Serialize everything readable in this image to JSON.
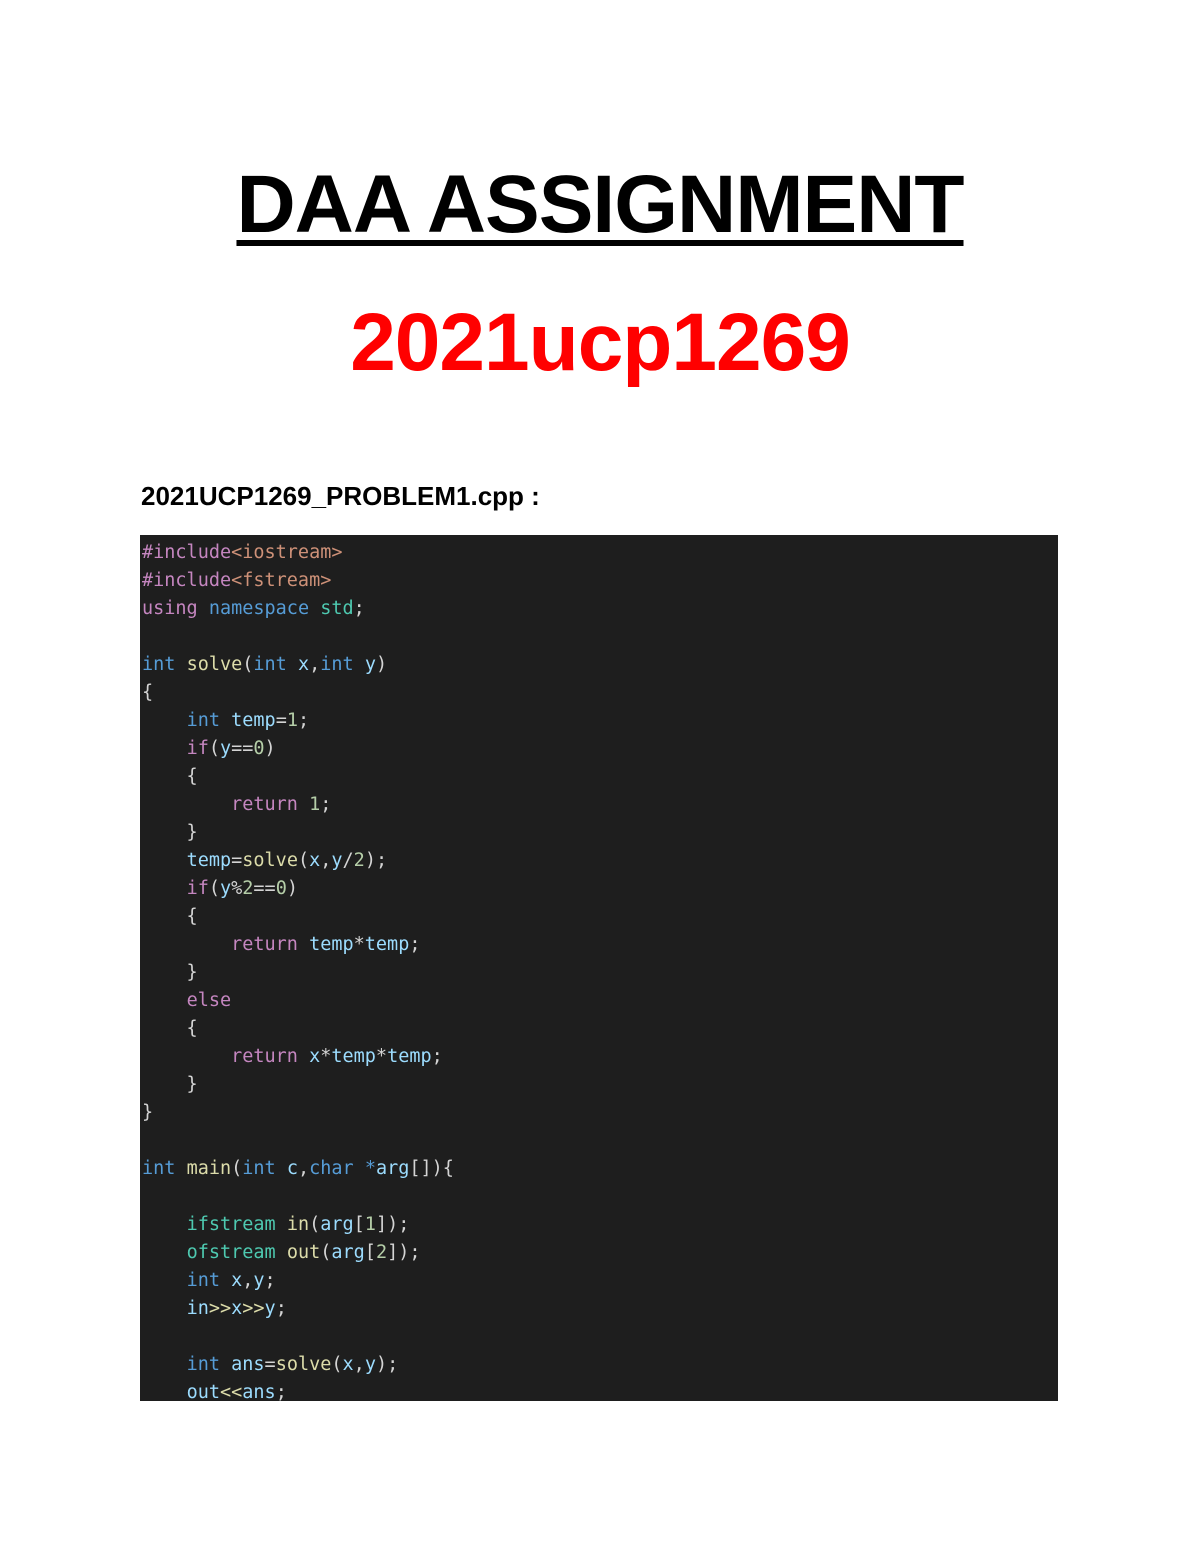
{
  "document": {
    "title": "DAA ASSIGNMENT",
    "roll_number": "2021ucp1269",
    "file_heading": "2021UCP1269_PROBLEM1.cpp :"
  },
  "colors": {
    "roll_number": "#ff0000",
    "code_background": "#1e1e1e"
  },
  "code": {
    "language": "cpp",
    "lines": [
      [
        [
          "pre",
          "#include"
        ],
        [
          "str",
          "<iostream>"
        ]
      ],
      [
        [
          "pre",
          "#include"
        ],
        [
          "str",
          "<fstream>"
        ]
      ],
      [
        [
          "kw",
          "using"
        ],
        [
          "p",
          " "
        ],
        [
          "type",
          "namespace"
        ],
        [
          "p",
          " "
        ],
        [
          "ns",
          "std"
        ],
        [
          "p",
          ";"
        ]
      ],
      [],
      [
        [
          "type",
          "int"
        ],
        [
          "p",
          " "
        ],
        [
          "fn",
          "solve"
        ],
        [
          "p",
          "("
        ],
        [
          "type",
          "int"
        ],
        [
          "p",
          " "
        ],
        [
          "var",
          "x"
        ],
        [
          "p",
          ","
        ],
        [
          "type",
          "int"
        ],
        [
          "p",
          " "
        ],
        [
          "var",
          "y"
        ],
        [
          "p",
          ")"
        ]
      ],
      [
        [
          "p",
          "{"
        ]
      ],
      [
        [
          "p",
          "    "
        ],
        [
          "type",
          "int"
        ],
        [
          "p",
          " "
        ],
        [
          "var",
          "temp"
        ],
        [
          "p",
          "="
        ],
        [
          "num",
          "1"
        ],
        [
          "p",
          ";"
        ]
      ],
      [
        [
          "p",
          "    "
        ],
        [
          "kw",
          "if"
        ],
        [
          "p",
          "("
        ],
        [
          "var",
          "y"
        ],
        [
          "p",
          "=="
        ],
        [
          "num",
          "0"
        ],
        [
          "p",
          ")"
        ]
      ],
      [
        [
          "p",
          "    {"
        ]
      ],
      [
        [
          "p",
          "        "
        ],
        [
          "kw",
          "return"
        ],
        [
          "p",
          " "
        ],
        [
          "num",
          "1"
        ],
        [
          "p",
          ";"
        ]
      ],
      [
        [
          "p",
          "    }"
        ]
      ],
      [
        [
          "p",
          "    "
        ],
        [
          "var",
          "temp"
        ],
        [
          "p",
          "="
        ],
        [
          "fn",
          "solve"
        ],
        [
          "p",
          "("
        ],
        [
          "var",
          "x"
        ],
        [
          "p",
          ","
        ],
        [
          "var",
          "y"
        ],
        [
          "p",
          "/"
        ],
        [
          "num",
          "2"
        ],
        [
          "p",
          ");"
        ]
      ],
      [
        [
          "p",
          "    "
        ],
        [
          "kw",
          "if"
        ],
        [
          "p",
          "("
        ],
        [
          "var",
          "y"
        ],
        [
          "p",
          "%"
        ],
        [
          "num",
          "2"
        ],
        [
          "p",
          "=="
        ],
        [
          "num",
          "0"
        ],
        [
          "p",
          ")"
        ]
      ],
      [
        [
          "p",
          "    {"
        ]
      ],
      [
        [
          "p",
          "        "
        ],
        [
          "kw",
          "return"
        ],
        [
          "p",
          " "
        ],
        [
          "var",
          "temp"
        ],
        [
          "p",
          "*"
        ],
        [
          "var",
          "temp"
        ],
        [
          "p",
          ";"
        ]
      ],
      [
        [
          "p",
          "    }"
        ]
      ],
      [
        [
          "p",
          "    "
        ],
        [
          "kw",
          "else"
        ]
      ],
      [
        [
          "p",
          "    {"
        ]
      ],
      [
        [
          "p",
          "        "
        ],
        [
          "kw",
          "return"
        ],
        [
          "p",
          " "
        ],
        [
          "var",
          "x"
        ],
        [
          "p",
          "*"
        ],
        [
          "var",
          "temp"
        ],
        [
          "p",
          "*"
        ],
        [
          "var",
          "temp"
        ],
        [
          "p",
          ";"
        ]
      ],
      [
        [
          "p",
          "    }"
        ]
      ],
      [
        [
          "p",
          "}"
        ]
      ],
      [],
      [
        [
          "type",
          "int"
        ],
        [
          "p",
          " "
        ],
        [
          "fn",
          "main"
        ],
        [
          "p",
          "("
        ],
        [
          "type",
          "int"
        ],
        [
          "p",
          " "
        ],
        [
          "var",
          "c"
        ],
        [
          "p",
          ","
        ],
        [
          "type",
          "char"
        ],
        [
          "p",
          " "
        ],
        [
          "type",
          "*"
        ],
        [
          "var",
          "arg"
        ],
        [
          "p",
          "[]){"
        ]
      ],
      [],
      [
        [
          "p",
          "    "
        ],
        [
          "cls",
          "ifstream"
        ],
        [
          "p",
          " "
        ],
        [
          "fn",
          "in"
        ],
        [
          "p",
          "("
        ],
        [
          "var",
          "arg"
        ],
        [
          "p",
          "["
        ],
        [
          "num",
          "1"
        ],
        [
          "p",
          "]);"
        ]
      ],
      [
        [
          "p",
          "    "
        ],
        [
          "cls",
          "ofstream"
        ],
        [
          "p",
          " "
        ],
        [
          "fn",
          "out"
        ],
        [
          "p",
          "("
        ],
        [
          "var",
          "arg"
        ],
        [
          "p",
          "["
        ],
        [
          "num",
          "2"
        ],
        [
          "p",
          "]);"
        ]
      ],
      [
        [
          "p",
          "    "
        ],
        [
          "type",
          "int"
        ],
        [
          "p",
          " "
        ],
        [
          "var",
          "x"
        ],
        [
          "p",
          ","
        ],
        [
          "var",
          "y"
        ],
        [
          "p",
          ";"
        ]
      ],
      [
        [
          "p",
          "    "
        ],
        [
          "var",
          "in"
        ],
        [
          "fn",
          ">>"
        ],
        [
          "var",
          "x"
        ],
        [
          "fn",
          ">>"
        ],
        [
          "var",
          "y"
        ],
        [
          "p",
          ";"
        ]
      ],
      [],
      [
        [
          "p",
          "    "
        ],
        [
          "type",
          "int"
        ],
        [
          "p",
          " "
        ],
        [
          "var",
          "ans"
        ],
        [
          "p",
          "="
        ],
        [
          "fn",
          "solve"
        ],
        [
          "p",
          "("
        ],
        [
          "var",
          "x"
        ],
        [
          "p",
          ","
        ],
        [
          "var",
          "y"
        ],
        [
          "p",
          ");"
        ]
      ],
      [
        [
          "p",
          "    "
        ],
        [
          "var",
          "out"
        ],
        [
          "fn",
          "<<"
        ],
        [
          "var",
          "ans"
        ],
        [
          "p",
          ";"
        ]
      ]
    ]
  }
}
